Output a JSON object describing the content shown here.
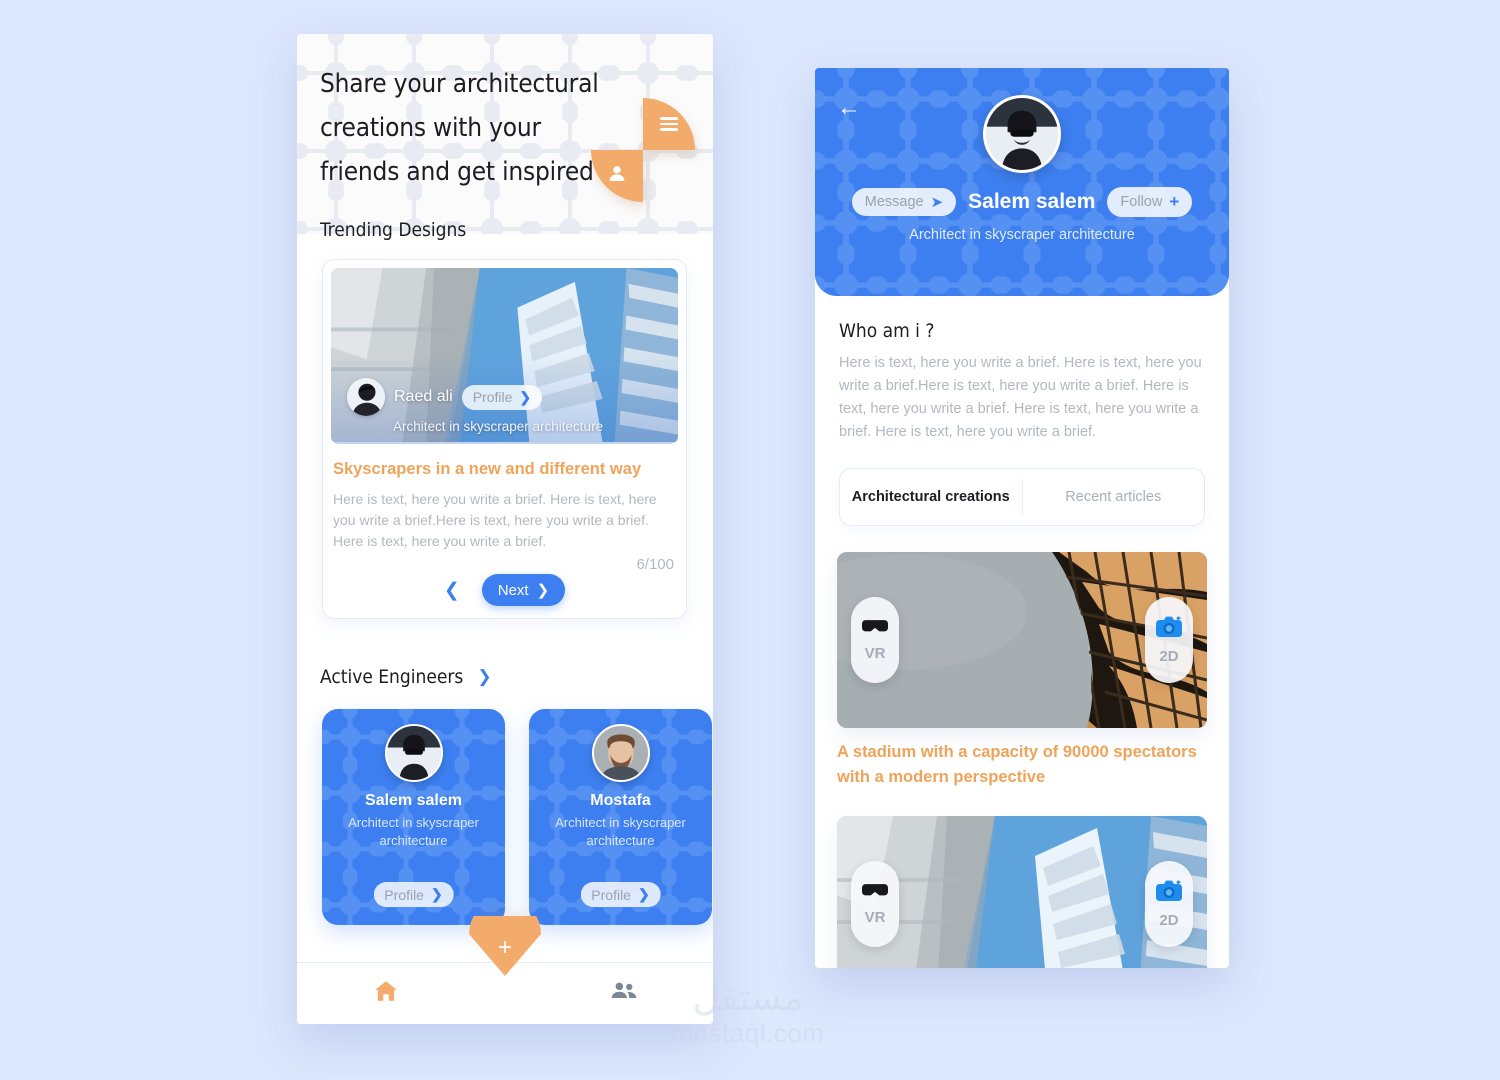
{
  "colors": {
    "page_bg": "#dde7fd",
    "blue": "#3d7ff0",
    "orange": "#f2ab6b",
    "orange_text": "#eea45a",
    "muted_text": "#b2b8c2"
  },
  "left_phone": {
    "hero": {
      "title": "Share your architectural creations with your friends and get inspired",
      "menu_icon": "hamburger-icon",
      "user_icon": "person-icon"
    },
    "trending": {
      "section_title": "Trending Designs",
      "card": {
        "author_name": "Raed ali",
        "author_role": "Architect in skyscraper architecture",
        "profile_button": "Profile",
        "profile_chevron": "chevron-right-icon",
        "heading": "Skyscrapers in a new and different way",
        "body": "Here is text, here you write a brief. Here is text, here you write a brief.Here is text, here you write a brief. Here is text, here you write a brief.",
        "counter": "6/100",
        "prev_icon": "chevron-left-icon",
        "next_label": "Next",
        "next_icon": "chevron-right-icon"
      }
    },
    "engineers": {
      "section_title": "Active Engineers",
      "more_icon": "chevron-right-icon",
      "cards": [
        {
          "name": "Salem salem",
          "role": "Architect in skyscraper architecture",
          "profile_button": "Profile"
        },
        {
          "name": "Mostafa",
          "role": "Architect in skyscraper architecture",
          "profile_button": "Profile"
        }
      ]
    },
    "fab": {
      "icon": "plus-icon",
      "label": "+"
    },
    "bottom_nav": [
      {
        "icon": "home-icon",
        "active": true
      },
      {
        "icon": "people-icon",
        "active": false
      }
    ]
  },
  "right_phone": {
    "header": {
      "back_icon": "arrow-left-icon",
      "avatar": "profile-avatar",
      "name": "Salem salem",
      "role": "Architect in skyscraper architecture",
      "message_button": "Message",
      "message_icon": "send-icon",
      "follow_button": "Follow",
      "follow_icon": "plus-icon"
    },
    "about": {
      "title": "Who am i ?",
      "text": "Here is text, here you write a brief. Here is text, here you write a brief.Here is text, here you write a brief. Here is text, here you write a brief. Here is text, here you write a brief. Here is text, here you write a brief."
    },
    "tabs": [
      {
        "label": "Architectural creations",
        "active": true
      },
      {
        "label": "Recent articles",
        "active": false
      }
    ],
    "works": [
      {
        "vr_label": "VR",
        "vr_icon": "vr-goggles-icon",
        "twod_label": "2D",
        "twod_icon": "camera-icon",
        "caption": "A stadium with a capacity of 90000 spectators with a modern perspective"
      },
      {
        "vr_label": "VR",
        "vr_icon": "vr-goggles-icon",
        "twod_label": "2D",
        "twod_icon": "camera-icon",
        "caption": ""
      }
    ]
  },
  "watermark": {
    "arabic": "مستقل",
    "latin": "mostaql.com"
  }
}
